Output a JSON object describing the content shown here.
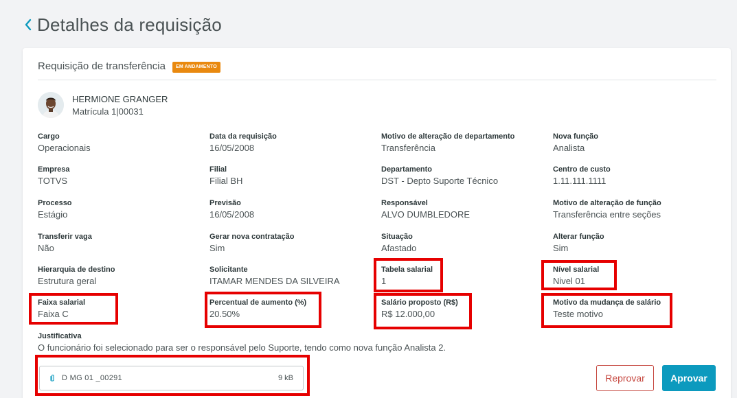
{
  "page": {
    "title": "Detalhes da requisição"
  },
  "card": {
    "title": "Requisição de transferência",
    "status": "EM ANDAMENTO"
  },
  "employee": {
    "name": "HERMIONE GRANGER",
    "registration": "Matrícula 1|00031"
  },
  "fields": {
    "cargo": {
      "label": "Cargo",
      "value": "Operacionais"
    },
    "data_requisicao": {
      "label": "Data da requisição",
      "value": "16/05/2008"
    },
    "motivo_departamento": {
      "label": "Motivo de alteração de departamento",
      "value": "Transferência"
    },
    "nova_funcao": {
      "label": "Nova função",
      "value": "Analista"
    },
    "empresa": {
      "label": "Empresa",
      "value": "TOTVS"
    },
    "filial": {
      "label": "Filial",
      "value": "Filial BH"
    },
    "departamento": {
      "label": "Departamento",
      "value": "DST - Depto Suporte Técnico"
    },
    "centro_custo": {
      "label": "Centro de custo",
      "value": "1.11.111.1111"
    },
    "processo": {
      "label": "Processo",
      "value": "Estágio"
    },
    "previsao": {
      "label": "Previsão",
      "value": "16/05/2008"
    },
    "responsavel": {
      "label": "Responsável",
      "value": "ALVO DUMBLEDORE"
    },
    "motivo_funcao": {
      "label": "Motivo de alteração de função",
      "value": "Transferência entre seções"
    },
    "transferir_vaga": {
      "label": "Transferir vaga",
      "value": "Não"
    },
    "nova_contratacao": {
      "label": "Gerar nova contratação",
      "value": "Sim"
    },
    "situacao": {
      "label": "Situação",
      "value": "Afastado"
    },
    "alterar_funcao": {
      "label": "Alterar função",
      "value": "Sim"
    },
    "hierarquia": {
      "label": "Hierarquia de destino",
      "value": "Estrutura geral"
    },
    "solicitante": {
      "label": "Solicitante",
      "value": "ITAMAR MENDES DA SILVEIRA"
    },
    "tabela_salarial": {
      "label": "Tabela salarial",
      "value": "1"
    },
    "nivel_salarial": {
      "label": "Nível salarial",
      "value": "Nivel 01"
    },
    "faixa_salarial": {
      "label": "Faixa salarial",
      "value": "Faixa C"
    },
    "percentual_aumento": {
      "label": "Percentual de aumento (%)",
      "value": "20.50%"
    },
    "salario_proposto": {
      "label": "Salário proposto (R$)",
      "value": "R$ 12.000,00"
    },
    "motivo_salario": {
      "label": "Motivo da mudança de salário",
      "value": "Teste motivo"
    },
    "justificativa": {
      "label": "Justificativa",
      "value": "O funcionário foi selecionado para ser o responsável pelo Suporte, tendo como nova função Analista 2."
    }
  },
  "attachment": {
    "name": "D MG 01 _00291",
    "size": "9 kB"
  },
  "actions": {
    "reject_label": "Reprovar",
    "approve_label": "Aprovar"
  },
  "colors": {
    "accent": "#0c9abe",
    "status_badge": "#e9890f",
    "reject": "#c64840",
    "highlight": "#e60000"
  },
  "icons": {
    "back": "chevron-left-icon",
    "attachment": "paperclip-icon"
  }
}
